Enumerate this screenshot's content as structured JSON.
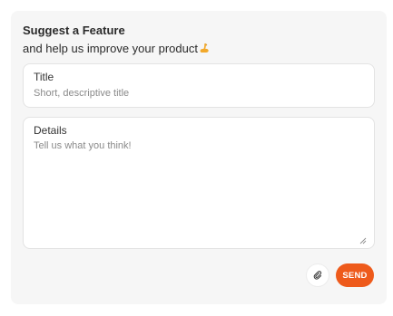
{
  "header": {
    "title": "Suggest a Feature",
    "subtitle": "and help us improve your product",
    "subtitle_icon": "flexed-biceps-emoji"
  },
  "form": {
    "title_field": {
      "label": "Title",
      "placeholder": "Short, descriptive title",
      "value": ""
    },
    "details_field": {
      "label": "Details",
      "placeholder": "Tell us what you think!",
      "value": ""
    }
  },
  "actions": {
    "attach_icon": "paperclip-icon",
    "send_label": "SEND"
  },
  "colors": {
    "card_background": "#f6f6f6",
    "accent": "#ee5a1b",
    "text": "#2b2b2b",
    "placeholder": "#8a8a8a"
  }
}
